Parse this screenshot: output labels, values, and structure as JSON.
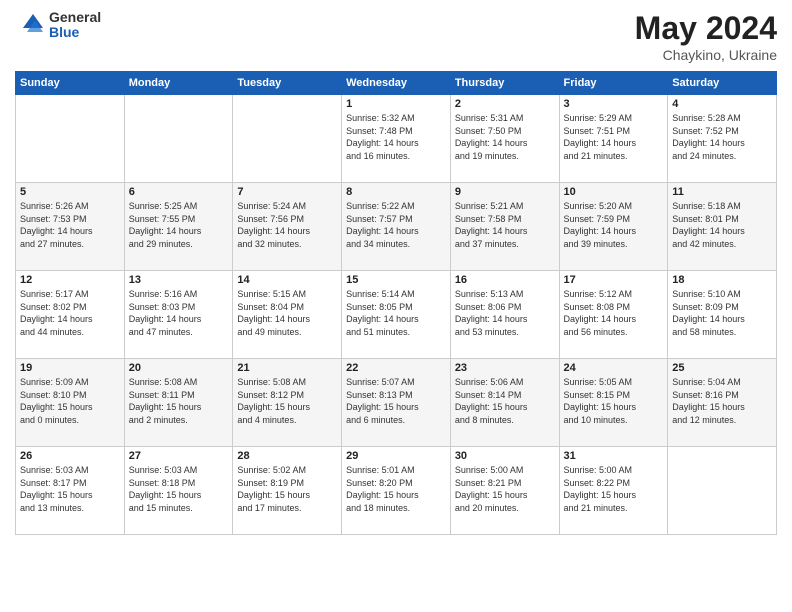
{
  "logo": {
    "general": "General",
    "blue": "Blue"
  },
  "title": "May 2024",
  "subtitle": "Chaykino, Ukraine",
  "days_header": [
    "Sunday",
    "Monday",
    "Tuesday",
    "Wednesday",
    "Thursday",
    "Friday",
    "Saturday"
  ],
  "weeks": [
    [
      {
        "day": "",
        "info": ""
      },
      {
        "day": "",
        "info": ""
      },
      {
        "day": "",
        "info": ""
      },
      {
        "day": "1",
        "info": "Sunrise: 5:32 AM\nSunset: 7:48 PM\nDaylight: 14 hours\nand 16 minutes."
      },
      {
        "day": "2",
        "info": "Sunrise: 5:31 AM\nSunset: 7:50 PM\nDaylight: 14 hours\nand 19 minutes."
      },
      {
        "day": "3",
        "info": "Sunrise: 5:29 AM\nSunset: 7:51 PM\nDaylight: 14 hours\nand 21 minutes."
      },
      {
        "day": "4",
        "info": "Sunrise: 5:28 AM\nSunset: 7:52 PM\nDaylight: 14 hours\nand 24 minutes."
      }
    ],
    [
      {
        "day": "5",
        "info": "Sunrise: 5:26 AM\nSunset: 7:53 PM\nDaylight: 14 hours\nand 27 minutes."
      },
      {
        "day": "6",
        "info": "Sunrise: 5:25 AM\nSunset: 7:55 PM\nDaylight: 14 hours\nand 29 minutes."
      },
      {
        "day": "7",
        "info": "Sunrise: 5:24 AM\nSunset: 7:56 PM\nDaylight: 14 hours\nand 32 minutes."
      },
      {
        "day": "8",
        "info": "Sunrise: 5:22 AM\nSunset: 7:57 PM\nDaylight: 14 hours\nand 34 minutes."
      },
      {
        "day": "9",
        "info": "Sunrise: 5:21 AM\nSunset: 7:58 PM\nDaylight: 14 hours\nand 37 minutes."
      },
      {
        "day": "10",
        "info": "Sunrise: 5:20 AM\nSunset: 7:59 PM\nDaylight: 14 hours\nand 39 minutes."
      },
      {
        "day": "11",
        "info": "Sunrise: 5:18 AM\nSunset: 8:01 PM\nDaylight: 14 hours\nand 42 minutes."
      }
    ],
    [
      {
        "day": "12",
        "info": "Sunrise: 5:17 AM\nSunset: 8:02 PM\nDaylight: 14 hours\nand 44 minutes."
      },
      {
        "day": "13",
        "info": "Sunrise: 5:16 AM\nSunset: 8:03 PM\nDaylight: 14 hours\nand 47 minutes."
      },
      {
        "day": "14",
        "info": "Sunrise: 5:15 AM\nSunset: 8:04 PM\nDaylight: 14 hours\nand 49 minutes."
      },
      {
        "day": "15",
        "info": "Sunrise: 5:14 AM\nSunset: 8:05 PM\nDaylight: 14 hours\nand 51 minutes."
      },
      {
        "day": "16",
        "info": "Sunrise: 5:13 AM\nSunset: 8:06 PM\nDaylight: 14 hours\nand 53 minutes."
      },
      {
        "day": "17",
        "info": "Sunrise: 5:12 AM\nSunset: 8:08 PM\nDaylight: 14 hours\nand 56 minutes."
      },
      {
        "day": "18",
        "info": "Sunrise: 5:10 AM\nSunset: 8:09 PM\nDaylight: 14 hours\nand 58 minutes."
      }
    ],
    [
      {
        "day": "19",
        "info": "Sunrise: 5:09 AM\nSunset: 8:10 PM\nDaylight: 15 hours\nand 0 minutes."
      },
      {
        "day": "20",
        "info": "Sunrise: 5:08 AM\nSunset: 8:11 PM\nDaylight: 15 hours\nand 2 minutes."
      },
      {
        "day": "21",
        "info": "Sunrise: 5:08 AM\nSunset: 8:12 PM\nDaylight: 15 hours\nand 4 minutes."
      },
      {
        "day": "22",
        "info": "Sunrise: 5:07 AM\nSunset: 8:13 PM\nDaylight: 15 hours\nand 6 minutes."
      },
      {
        "day": "23",
        "info": "Sunrise: 5:06 AM\nSunset: 8:14 PM\nDaylight: 15 hours\nand 8 minutes."
      },
      {
        "day": "24",
        "info": "Sunrise: 5:05 AM\nSunset: 8:15 PM\nDaylight: 15 hours\nand 10 minutes."
      },
      {
        "day": "25",
        "info": "Sunrise: 5:04 AM\nSunset: 8:16 PM\nDaylight: 15 hours\nand 12 minutes."
      }
    ],
    [
      {
        "day": "26",
        "info": "Sunrise: 5:03 AM\nSunset: 8:17 PM\nDaylight: 15 hours\nand 13 minutes."
      },
      {
        "day": "27",
        "info": "Sunrise: 5:03 AM\nSunset: 8:18 PM\nDaylight: 15 hours\nand 15 minutes."
      },
      {
        "day": "28",
        "info": "Sunrise: 5:02 AM\nSunset: 8:19 PM\nDaylight: 15 hours\nand 17 minutes."
      },
      {
        "day": "29",
        "info": "Sunrise: 5:01 AM\nSunset: 8:20 PM\nDaylight: 15 hours\nand 18 minutes."
      },
      {
        "day": "30",
        "info": "Sunrise: 5:00 AM\nSunset: 8:21 PM\nDaylight: 15 hours\nand 20 minutes."
      },
      {
        "day": "31",
        "info": "Sunrise: 5:00 AM\nSunset: 8:22 PM\nDaylight: 15 hours\nand 21 minutes."
      },
      {
        "day": "",
        "info": ""
      }
    ]
  ]
}
